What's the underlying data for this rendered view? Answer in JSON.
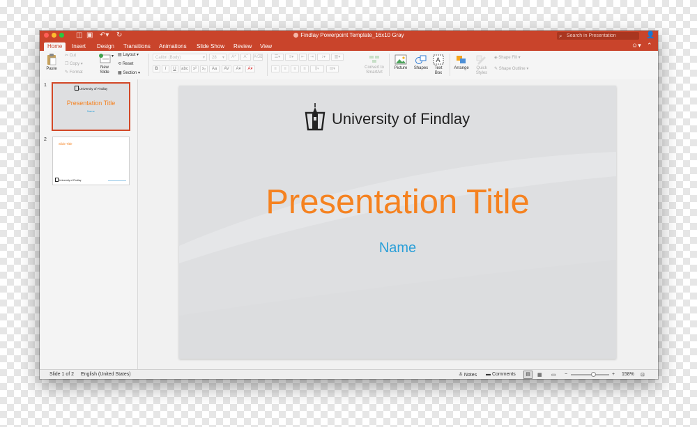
{
  "window": {
    "title": "Findlay Powerpoint Template_16x10 Gray"
  },
  "search": {
    "placeholder": "Search in Presentation"
  },
  "tabs": [
    "Home",
    "Insert",
    "Design",
    "Transitions",
    "Animations",
    "Slide Show",
    "Review",
    "View"
  ],
  "ribbon": {
    "paste": "Paste",
    "cut": "Cut",
    "copy": "Copy",
    "format": "Format",
    "new_slide": "New Slide",
    "layout": "Layout",
    "reset": "Reset",
    "section": "Section",
    "font_name": "Calibri (Body)",
    "font_size": "28",
    "convert_smartart": "Convert to SmartArt",
    "picture": "Picture",
    "shapes": "Shapes",
    "text_box": "Text Box",
    "arrange": "Arrange",
    "quick_styles": "Quick Styles",
    "shape_fill": "Shape Fill",
    "shape_outline": "Shape Outline"
  },
  "thumbnails": [
    {
      "num": "1",
      "logo": "University of Findlay",
      "title": "Presentation Title",
      "name": "Name"
    },
    {
      "num": "2",
      "title": "Slide Title",
      "logo": "University of Findlay"
    }
  ],
  "slide": {
    "logo_text": "University of Findlay",
    "title": "Presentation Title",
    "name": "Name"
  },
  "status": {
    "slide_pos": "Slide 1 of 2",
    "language": "English (United States)",
    "notes": "Notes",
    "comments": "Comments",
    "zoom": "158%"
  },
  "colors": {
    "accent": "#c9442b",
    "title_orange": "#f58220",
    "name_blue": "#2a9fd8"
  }
}
